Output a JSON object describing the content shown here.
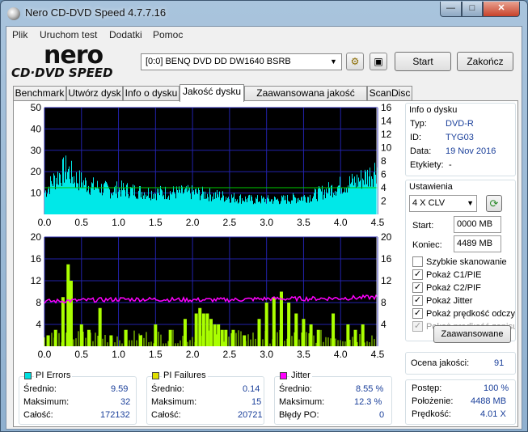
{
  "window": {
    "title": "Nero CD-DVD Speed 4.7.7.16",
    "min": "—",
    "max": "□",
    "close": "✕"
  },
  "menu": [
    "Plik",
    "Uruchom test",
    "Dodatki",
    "Pomoc"
  ],
  "logo": {
    "word": "nero",
    "sub": "CD·DVD SPEED"
  },
  "drive": {
    "selected": "[0:0]   BENQ DVD DD DW1640 BSRB"
  },
  "buttons": {
    "start": "Start",
    "exit": "Zakończ",
    "advanced": "Zaawansowane"
  },
  "tabs": [
    "Benchmark",
    "Utwórz dysk",
    "Info o dysku",
    "Jakość dysku",
    "Zaawansowana jakość dysku",
    "ScanDisc"
  ],
  "active_tab": 3,
  "disc_info": {
    "title": "Info o dysku",
    "rows": [
      {
        "k": "Typ:",
        "v": "DVD-R"
      },
      {
        "k": "ID:",
        "v": "TYG03"
      },
      {
        "k": "Data:",
        "v": "19 Nov 2016"
      },
      {
        "k": "Etykiety:",
        "v": "-"
      }
    ]
  },
  "settings": {
    "title": "Ustawienia",
    "speed": "4 X CLV",
    "start_label": "Start:",
    "start_value": "0000 MB",
    "end_label": "Koniec:",
    "end_value": "4489 MB",
    "checks": [
      {
        "label": "Szybkie skanowanie",
        "checked": false,
        "disabled": false
      },
      {
        "label": "Pokaż C1/PIE",
        "checked": true,
        "disabled": false
      },
      {
        "label": "Pokaż C2/PIF",
        "checked": true,
        "disabled": false
      },
      {
        "label": "Pokaż Jitter",
        "checked": true,
        "disabled": false
      },
      {
        "label": "Pokaż prędkość odczytu",
        "checked": true,
        "disabled": false
      },
      {
        "label": "Pokaż prędkość zapisu",
        "checked": true,
        "disabled": true
      }
    ]
  },
  "quality": {
    "label": "Ocena jakości:",
    "value": "91"
  },
  "progress": [
    {
      "k": "Postęp:",
      "v": "100 %"
    },
    {
      "k": "Położenie:",
      "v": "4488 MB"
    },
    {
      "k": "Prędkość:",
      "v": "4.01 X"
    }
  ],
  "stats": {
    "pi_errors": {
      "title": "PI Errors",
      "color": "#00e0e0",
      "rows": [
        {
          "k": "Średnio:",
          "v": "9.59"
        },
        {
          "k": "Maksimum:",
          "v": "32"
        },
        {
          "k": "Całość:",
          "v": "172132"
        }
      ]
    },
    "pi_failures": {
      "title": "PI Failures",
      "color": "#e0e000",
      "rows": [
        {
          "k": "Średnio:",
          "v": "0.14"
        },
        {
          "k": "Maksimum:",
          "v": "15"
        },
        {
          "k": "Całość:",
          "v": "20721"
        }
      ]
    },
    "jitter": {
      "title": "Jitter",
      "color": "#ff00ff",
      "rows": [
        {
          "k": "Średnio:",
          "v": "8.55 %"
        },
        {
          "k": "Maksimum:",
          "v": "12.3 %"
        },
        {
          "k": "Błędy PO:",
          "v": "0"
        }
      ]
    }
  },
  "chart_data": [
    {
      "type": "area",
      "name": "PI Errors",
      "x_ticks": [
        "0.0",
        "0.5",
        "1.0",
        "1.5",
        "2.0",
        "2.5",
        "3.0",
        "3.5",
        "4.0",
        "4.5"
      ],
      "y_left_ticks": [
        "50",
        "40",
        "30",
        "20",
        "10"
      ],
      "y_right_ticks": [
        "16",
        "14",
        "12",
        "10",
        "8",
        "6",
        "4",
        "2"
      ],
      "xlim": [
        0,
        4.5
      ],
      "ylim": [
        0,
        50
      ],
      "y2lim": [
        0,
        16
      ],
      "colors": {
        "bg": "#000000",
        "grid": "#2222aa",
        "pie": "#00e8e8",
        "speed": "#00cc00"
      },
      "x": [
        0.0,
        0.1,
        0.2,
        0.3,
        0.4,
        0.5,
        0.6,
        0.7,
        0.8,
        0.9,
        1.0,
        1.2,
        1.4,
        1.6,
        1.8,
        2.0,
        2.2,
        2.4,
        2.6,
        2.8,
        3.0,
        3.2,
        3.4,
        3.6,
        3.8,
        4.0,
        4.2,
        4.4,
        4.49
      ],
      "values": [
        12,
        18,
        22,
        25,
        20,
        18,
        16,
        15,
        14,
        13,
        14,
        13,
        12,
        12,
        12,
        12,
        11,
        10,
        9,
        8,
        8,
        8,
        9,
        10,
        13,
        16,
        18,
        22,
        26
      ],
      "peaks": [
        0.3,
        0.35,
        0.5,
        0.55
      ],
      "read_speed_x": 4.0
    },
    {
      "type": "bar",
      "name": "PI Failures / Jitter",
      "x_ticks": [
        "0.0",
        "0.5",
        "1.0",
        "1.5",
        "2.0",
        "2.5",
        "3.0",
        "3.5",
        "4.0",
        "4.5"
      ],
      "y_left_ticks": [
        "20",
        "16",
        "12",
        "8",
        "4"
      ],
      "y_right_ticks": [
        "20",
        "16",
        "12",
        "8",
        "4"
      ],
      "xlim": [
        0,
        4.5
      ],
      "ylim": [
        0,
        20
      ],
      "colors": {
        "bg": "#000000",
        "grid": "#2222aa",
        "pif": "#aaff00",
        "jitter": "#ff00ff"
      },
      "pif_x": [
        0.05,
        0.15,
        0.25,
        0.32,
        0.36,
        0.5,
        0.6,
        0.75,
        0.9,
        1.1,
        1.3,
        1.5,
        1.7,
        1.9,
        2.05,
        2.1,
        2.15,
        2.2,
        2.25,
        2.3,
        2.35,
        2.4,
        2.45,
        2.55,
        2.7,
        2.9,
        3.0,
        3.1,
        3.2,
        3.3,
        3.4,
        3.5,
        3.6,
        3.7,
        3.9,
        4.1,
        4.2,
        4.3
      ],
      "pif_values": [
        2,
        3,
        9,
        15,
        12,
        4,
        3,
        7,
        2,
        3,
        2,
        4,
        3,
        5,
        6,
        7,
        6,
        6,
        5,
        4,
        4,
        3,
        3,
        3,
        2,
        5,
        8,
        9,
        10,
        8,
        6,
        5,
        4,
        3,
        6,
        4,
        3,
        4
      ],
      "jitter_x": [
        0.0,
        0.5,
        1.0,
        1.5,
        2.0,
        2.5,
        3.0,
        3.5,
        4.0,
        4.5
      ],
      "jitter_values": [
        8.2,
        8.4,
        8.6,
        8.6,
        8.5,
        8.5,
        8.7,
        8.7,
        8.8,
        9.0
      ]
    }
  ]
}
